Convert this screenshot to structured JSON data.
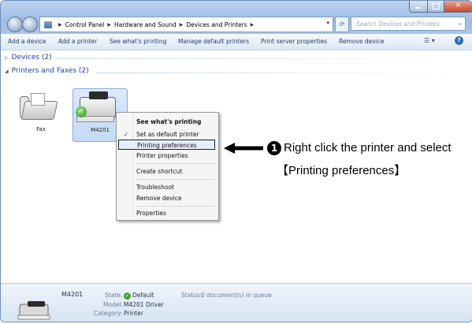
{
  "address_bar": {
    "crumbs": [
      "Control Panel",
      "Hardware and Sound",
      "Devices and Printers"
    ],
    "search_placeholder": "Search Devices and Printers"
  },
  "toolbar": {
    "items": [
      "Add a device",
      "Add a printer",
      "See what's printing",
      "Manage default printers",
      "Print server properties",
      "Remove device"
    ]
  },
  "groups": {
    "devices": "Devices (2)",
    "printers": "Printers and Faxes (2)"
  },
  "devices": {
    "fax": "Fax",
    "m4201": "M4201"
  },
  "context_menu": {
    "items": [
      "See what's printing",
      "Set as default printer",
      "Printing preferences",
      "Printer properties",
      "Create shortcut",
      "Troubleshoot",
      "Remove device",
      "Properties"
    ],
    "checked_item": "Set as default printer",
    "highlighted_item": "Printing preferences"
  },
  "annotation": {
    "step": "1",
    "line1": "Right click the printer and select",
    "line2": "【Printing preferences】"
  },
  "details": {
    "name": "M4201",
    "state_label": "State:",
    "state_value": "Default",
    "status_label": "Status:",
    "status_value": "0 document(s) in queue",
    "model_label": "Model:",
    "model_value": "M4201 Driver",
    "category_label": "Category:",
    "category_value": "Printer"
  },
  "colors": {
    "link": "#1e3fa1",
    "highlight_border": "#222222",
    "default_check": "#2a8f1f"
  }
}
